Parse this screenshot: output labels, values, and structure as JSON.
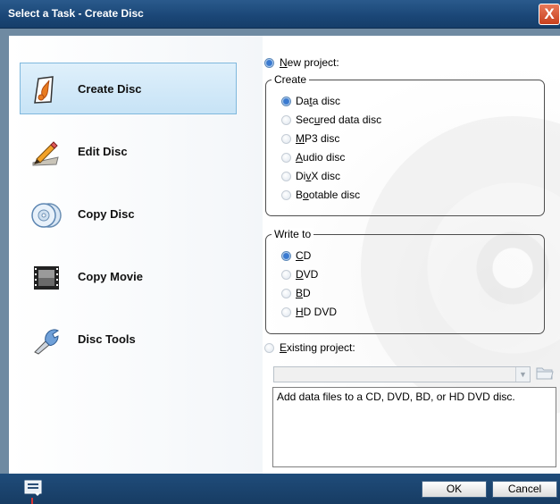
{
  "window": {
    "title": "Select a Task - Create Disc",
    "close_glyph": "X"
  },
  "sidebar": {
    "items": [
      {
        "label": "Create Disc",
        "icon": "create-disc-icon",
        "active": true
      },
      {
        "label": "Edit Disc",
        "icon": "edit-disc-icon",
        "active": false
      },
      {
        "label": "Copy Disc",
        "icon": "copy-disc-icon",
        "active": false
      },
      {
        "label": "Copy Movie",
        "icon": "copy-movie-icon",
        "active": false
      },
      {
        "label": "Disc Tools",
        "icon": "disc-tools-icon",
        "active": false
      }
    ]
  },
  "new_project": {
    "label": "New project:",
    "accel": "N",
    "selected": true
  },
  "create_group": {
    "legend": "Create",
    "options": [
      {
        "pre": "Da",
        "accel": "t",
        "post": "a disc",
        "selected": true
      },
      {
        "pre": "Sec",
        "accel": "u",
        "post": "red data disc",
        "selected": false
      },
      {
        "pre": "",
        "accel": "M",
        "post": "P3 disc",
        "selected": false
      },
      {
        "pre": "",
        "accel": "A",
        "post": "udio disc",
        "selected": false
      },
      {
        "pre": "Di",
        "accel": "v",
        "post": "X disc",
        "selected": false
      },
      {
        "pre": "B",
        "accel": "o",
        "post": "otable disc",
        "selected": false
      }
    ]
  },
  "write_group": {
    "legend": "Write to",
    "options": [
      {
        "pre": "",
        "accel": "C",
        "post": "D",
        "selected": true
      },
      {
        "pre": "",
        "accel": "D",
        "post": "VD",
        "selected": false
      },
      {
        "pre": "",
        "accel": "B",
        "post": "D",
        "selected": false
      },
      {
        "pre": "",
        "accel": "H",
        "post": "D DVD",
        "selected": false
      }
    ]
  },
  "existing_project": {
    "label": "Existing project:",
    "accel": "E",
    "selected": false,
    "value": ""
  },
  "description": "Add data files to a CD, DVD, BD, or HD DVD disc.",
  "buttons": {
    "ok": "OK",
    "cancel": "Cancel"
  },
  "colors": {
    "title_bar": "#1a4676",
    "frame": "#6f8aa2",
    "active_task": "#c7e3f6",
    "radio_selected": "#3a7ad0",
    "close": "#c8401e"
  }
}
